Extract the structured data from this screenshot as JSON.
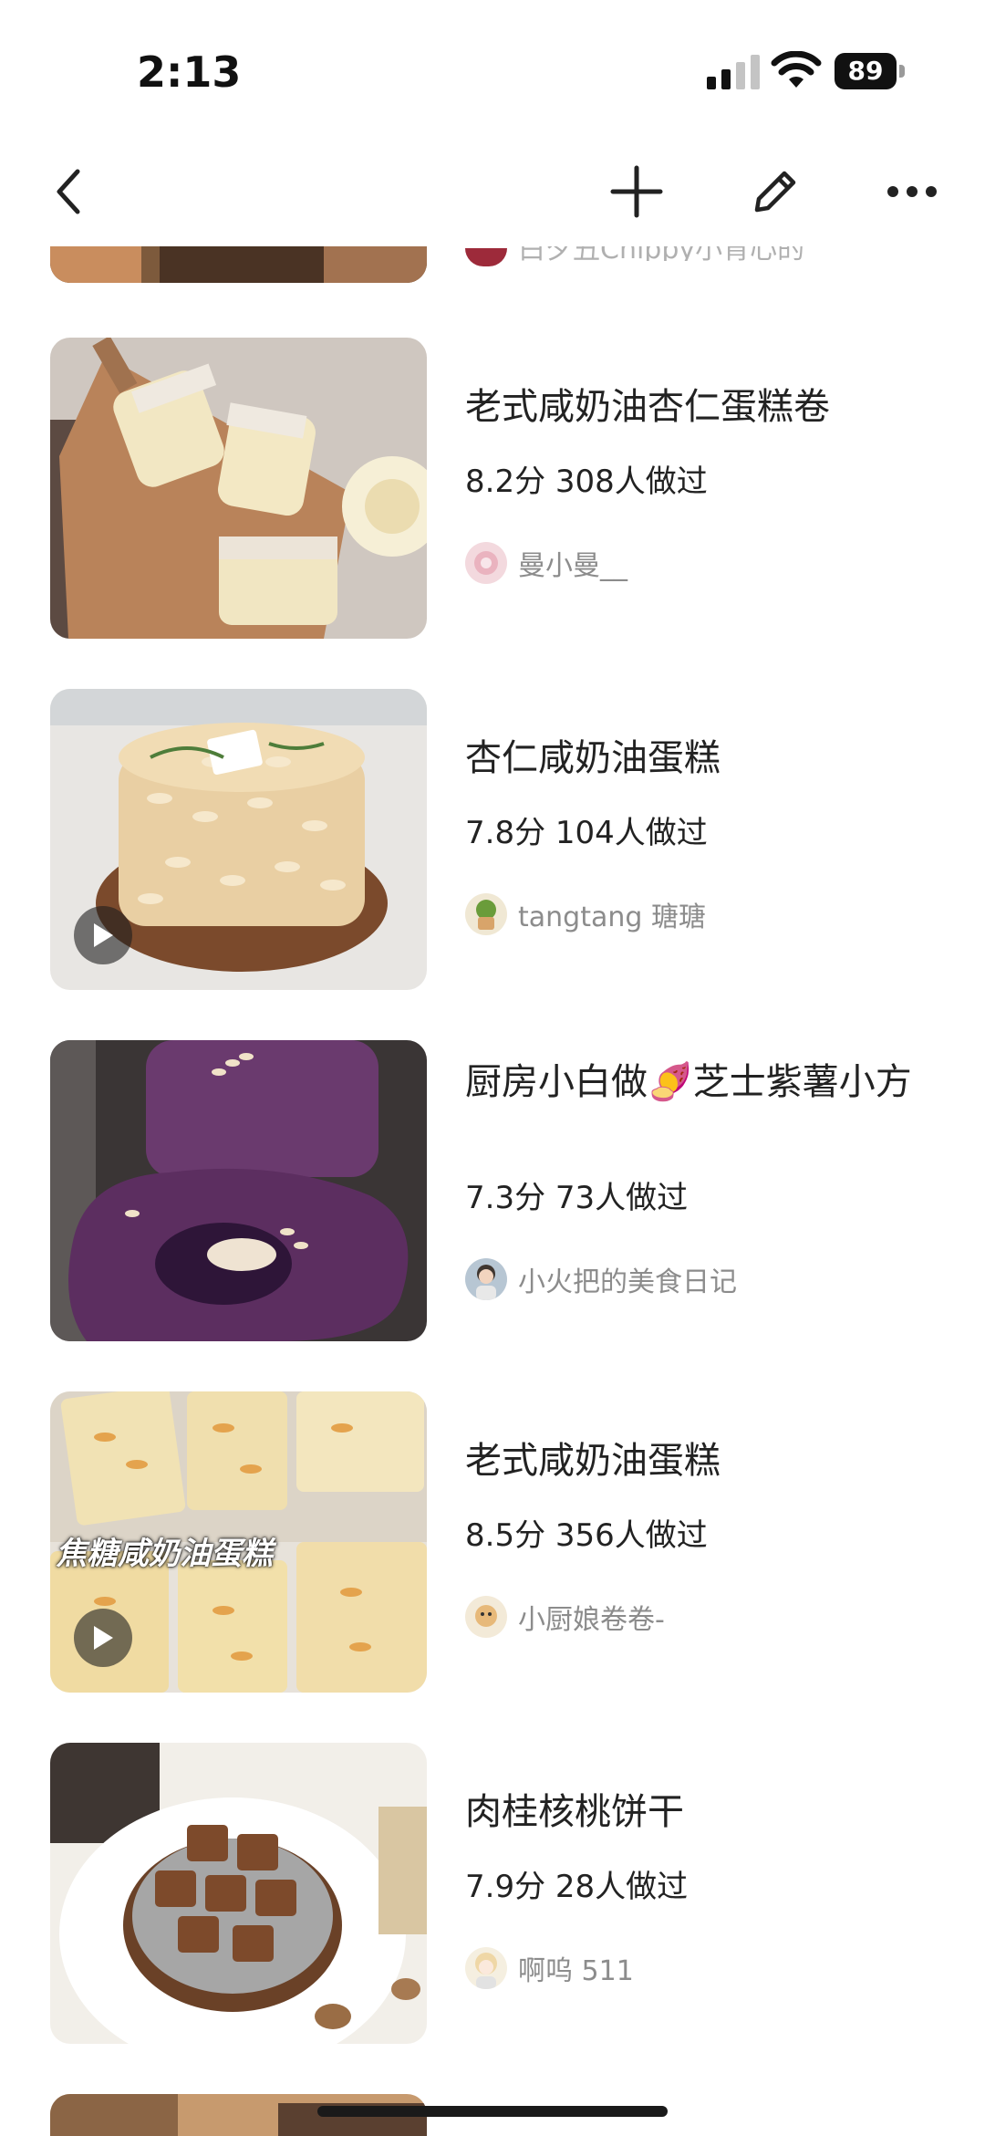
{
  "status_bar": {
    "time": "2:13",
    "battery": "89"
  },
  "nav": {
    "back_icon": "chevron-left-icon",
    "add_icon": "plus-icon",
    "edit_icon": "pencil-icon",
    "more_icon": "more-horizontal-icon"
  },
  "recipes": [
    {
      "title": "老式咸奶油杏仁蛋糕卷",
      "stats": "8.2分 308人做过",
      "author": "曼小曼__",
      "has_video": false
    },
    {
      "title": "杏仁咸奶油蛋糕",
      "stats": "7.8分 104人做过",
      "author": "tangtang 瑭瑭",
      "has_video": true
    },
    {
      "title": "厨房小白做🍠芝士紫薯小方",
      "stats": "7.3分 73人做过",
      "author": "小火把的美食日记",
      "has_video": false
    },
    {
      "title": "老式咸奶油蛋糕",
      "stats": "8.5分 356人做过",
      "author": "小厨娘卷卷-",
      "has_video": true,
      "thumb_overlay": "焦糖咸奶油蛋糕"
    },
    {
      "title": "肉桂核桃饼干",
      "stats": "7.9分 28人做过",
      "author": "啊呜 511",
      "has_video": false
    }
  ],
  "colors": {
    "text": "#222222",
    "secondary": "#8c8c8c",
    "background": "#ffffff"
  }
}
